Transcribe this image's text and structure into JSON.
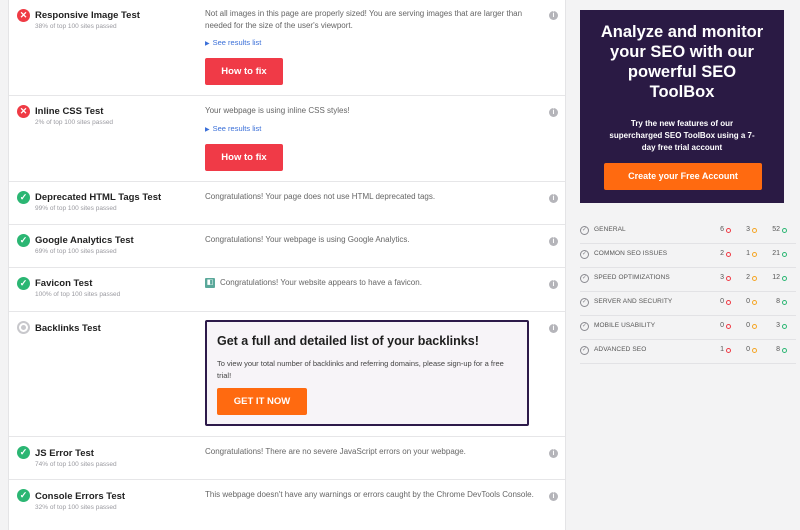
{
  "tests": [
    {
      "key": "responsive",
      "name": "Responsive Image Test",
      "sub": "38% of top 100 sites passed",
      "status": "fail",
      "message": "Not all images in this page are properly sized! You are serving images that are larger than needed for the size of the user's viewport.",
      "link": "See results list",
      "button": "How to fix"
    },
    {
      "key": "inline-css",
      "name": "Inline CSS Test",
      "sub": "2% of top 100 sites passed",
      "status": "fail",
      "message": "Your webpage is using inline CSS styles!",
      "link": "See results list",
      "button": "How to fix"
    },
    {
      "key": "deprecated-html",
      "name": "Deprecated HTML Tags Test",
      "sub": "99% of top 100 sites passed",
      "status": "pass",
      "message": "Congratulations! Your page does not use HTML deprecated tags."
    },
    {
      "key": "google-analytics",
      "name": "Google Analytics Test",
      "sub": "69% of top 100 sites passed",
      "status": "pass",
      "message": "Congratulations! Your webpage is using Google Analytics."
    },
    {
      "key": "favicon",
      "name": "Favicon Test",
      "sub": "100% of top 100 sites passed",
      "status": "pass",
      "message": "Congratulations! Your website appears to have a favicon."
    },
    {
      "key": "backlinks",
      "name": "Backlinks Test",
      "status": "neutral",
      "box": {
        "title": "Get a full and detailed list of your backlinks!",
        "desc": "To view your total number of backlinks and referring domains, please sign-up for a free trial!",
        "button": "GET IT NOW"
      }
    },
    {
      "key": "js-error",
      "name": "JS Error Test",
      "sub": "74% of top 100 sites passed",
      "status": "pass",
      "message": "Congratulations! There are no severe JavaScript errors on your webpage."
    },
    {
      "key": "console-errors",
      "name": "Console Errors Test",
      "sub": "32% of top 100 sites passed",
      "status": "pass",
      "message": "This webpage doesn't have any warnings or errors caught by the Chrome DevTools Console."
    }
  ],
  "promo": {
    "title": "Analyze and monitor your SEO with our powerful SEO ToolBox",
    "subtitle": "Try the new features of our supercharged SEO ToolBox using a 7-day free trial account",
    "button": "Create your Free Account"
  },
  "categories": [
    {
      "name": "GENERAL",
      "fail": "6",
      "warn": "3",
      "pass": "52"
    },
    {
      "name": "COMMON SEO ISSUES",
      "fail": "2",
      "warn": "1",
      "pass": "21"
    },
    {
      "name": "SPEED OPTIMIZATIONS",
      "fail": "3",
      "warn": "2",
      "pass": "12"
    },
    {
      "name": "SERVER AND SECURITY",
      "fail": "0",
      "warn": "0",
      "pass": "8"
    },
    {
      "name": "MOBILE USABILITY",
      "fail": "0",
      "warn": "0",
      "pass": "3"
    },
    {
      "name": "ADVANCED SEO",
      "fail": "1",
      "warn": "0",
      "pass": "8"
    }
  ],
  "colors": {
    "fail": "#ef3b45",
    "pass": "#2bb673",
    "warn": "#f5a524",
    "accent": "#ff6a10",
    "promo_bg": "#2a1a44"
  },
  "icons": {
    "fail": "close-icon",
    "pass": "check-icon",
    "info": "info-icon",
    "neutral": "circle-icon"
  }
}
